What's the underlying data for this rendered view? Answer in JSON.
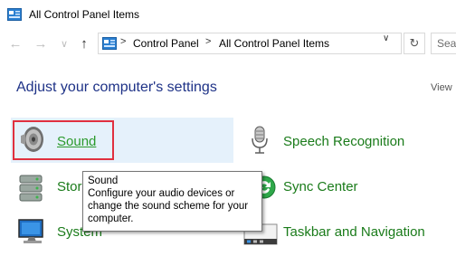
{
  "window": {
    "title": "All Control Panel Items"
  },
  "nav": {
    "back_glyph": "←",
    "forward_glyph": "→",
    "dropdown_glyph": "∨",
    "up_glyph": "↑",
    "breadcrumbs": [
      "Control Panel",
      "All Control Panel Items"
    ],
    "separator": ">",
    "refresh_glyph": "↻",
    "search_placeholder": "Sea"
  },
  "content": {
    "heading": "Adjust your computer's settings",
    "view_by": "View",
    "items": {
      "sound": "Sound",
      "storage": "Stor",
      "system": "System",
      "speech": "Speech Recognition",
      "sync": "Sync Center",
      "taskbar": "Taskbar and Navigation"
    }
  },
  "tooltip": {
    "title": "Sound",
    "line1": "Configure your audio devices or",
    "line2": "change the sound scheme for your",
    "line3": "computer."
  },
  "colors": {
    "link_green": "#1a7b1a",
    "heading_blue": "#1e3287",
    "hover_bg": "#e5f1fb",
    "highlight_red": "#e0303f"
  }
}
